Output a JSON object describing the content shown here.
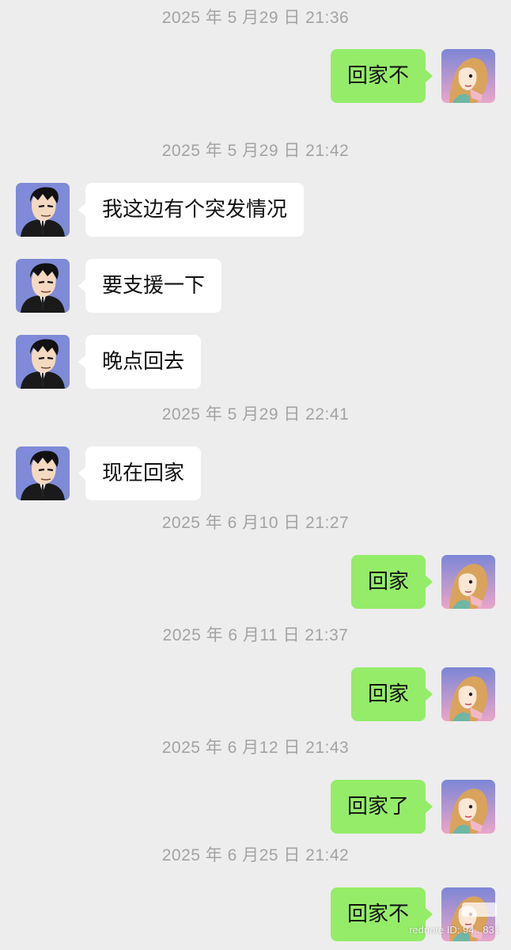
{
  "app": {
    "name": "chat"
  },
  "messages": [
    {
      "type": "time",
      "text": "2025 年 5 月29 日  21:36"
    },
    {
      "type": "msg",
      "from": "me",
      "text": "回家不"
    },
    {
      "type": "time",
      "text": "2025 年 5 月29 日  21:42"
    },
    {
      "type": "msg",
      "from": "other",
      "text": "我这边有个突发情况"
    },
    {
      "type": "msg",
      "from": "other",
      "text": "要支援一下"
    },
    {
      "type": "msg",
      "from": "other",
      "text": "晚点回去"
    },
    {
      "type": "time",
      "text": "2025 年 5 月29 日  22:41"
    },
    {
      "type": "msg",
      "from": "other",
      "text": "现在回家"
    },
    {
      "type": "time",
      "text": "2025 年 6 月10 日  21:27"
    },
    {
      "type": "msg",
      "from": "me",
      "text": "回家"
    },
    {
      "type": "time",
      "text": "2025 年 6 月11 日  21:37"
    },
    {
      "type": "msg",
      "from": "me",
      "text": "回家"
    },
    {
      "type": "time",
      "text": "2025 年 6 月12 日  21:43"
    },
    {
      "type": "msg",
      "from": "me",
      "text": "回家了"
    },
    {
      "type": "time",
      "text": "2025 年 6 月25 日  21:42"
    },
    {
      "type": "msg",
      "from": "me",
      "text": "回家不"
    }
  ],
  "watermark": {
    "text": "rednote ID: 94...831"
  },
  "colors": {
    "background": "#ededed",
    "outgoing_bubble": "#95ec69",
    "incoming_bubble": "#ffffff",
    "timestamp": "#a3a3a3"
  },
  "icons": {
    "me_avatar": "cartoon-woman-avatar-icon",
    "other_avatar": "cartoon-man-in-suit-avatar-icon"
  }
}
